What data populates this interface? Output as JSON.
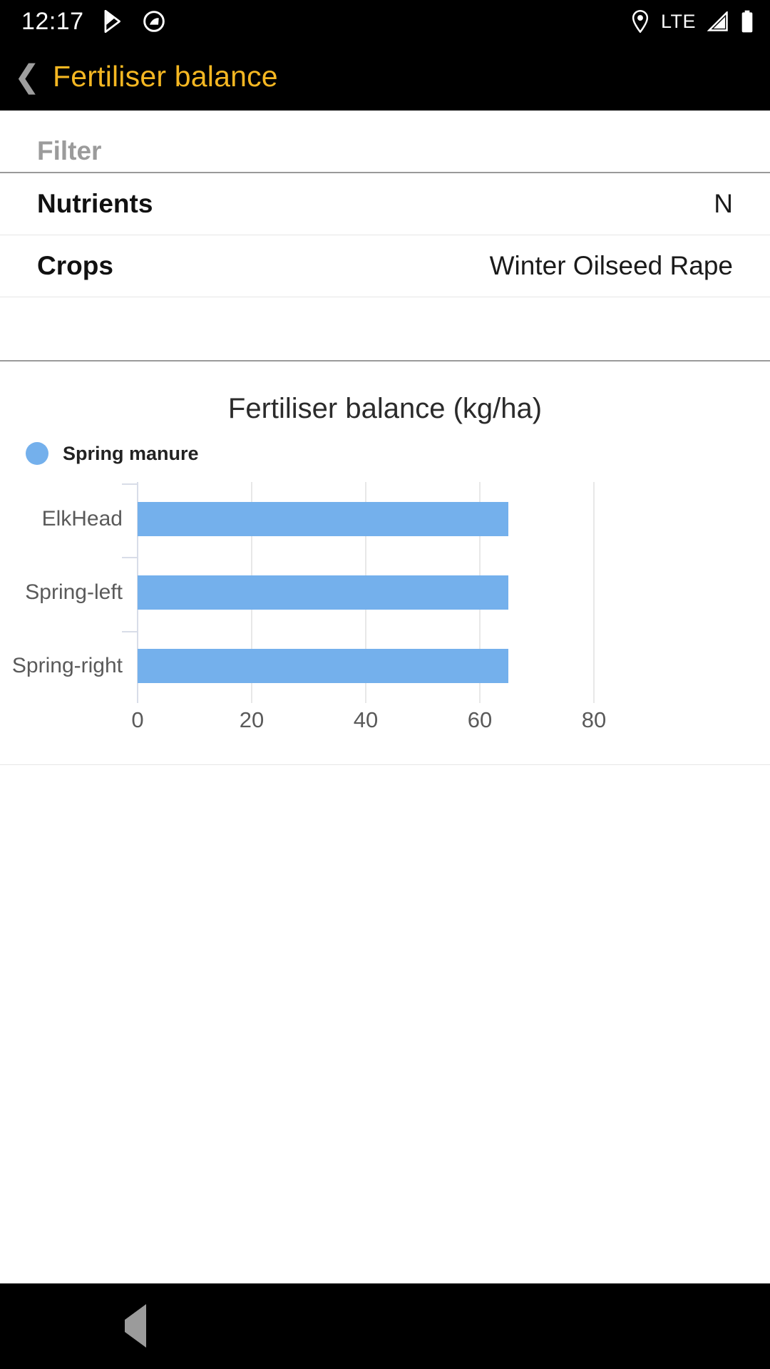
{
  "status_bar": {
    "time": "12:17",
    "network_label": "LTE",
    "icons": [
      "play-store-icon",
      "do-not-disturb-icon",
      "location-pin-icon",
      "signal-icon",
      "battery-icon"
    ]
  },
  "app_bar": {
    "back_label": "❮",
    "title": "Fertiliser balance",
    "title_color": "#f5b722"
  },
  "filter": {
    "header": "Filter",
    "rows": [
      {
        "label": "Nutrients",
        "value": "N"
      },
      {
        "label": "Crops",
        "value": "Winter Oilseed Rape"
      }
    ]
  },
  "chart_card": {
    "legend": [
      {
        "label": "Spring manure",
        "color": "#74b0ec"
      }
    ]
  },
  "chart_data": {
    "type": "bar",
    "orientation": "horizontal",
    "title": "Fertiliser balance (kg/ha)",
    "xlabel": "",
    "ylabel": "",
    "categories": [
      "ElkHead",
      "Spring-left",
      "Spring-right"
    ],
    "series": [
      {
        "name": "Spring manure",
        "color": "#74b0ec",
        "values": [
          65,
          65,
          65
        ]
      }
    ],
    "xlim": [
      0,
      80
    ],
    "xticks": [
      0,
      20,
      40,
      60,
      80
    ],
    "xtick_labels": [
      "0",
      "20",
      "40",
      "60",
      "80"
    ],
    "grid": true,
    "legend_position": "top-left"
  },
  "nav_bar": {
    "items": [
      "back-triangle-icon",
      "home-circle-icon",
      "recents-square-icon"
    ]
  }
}
